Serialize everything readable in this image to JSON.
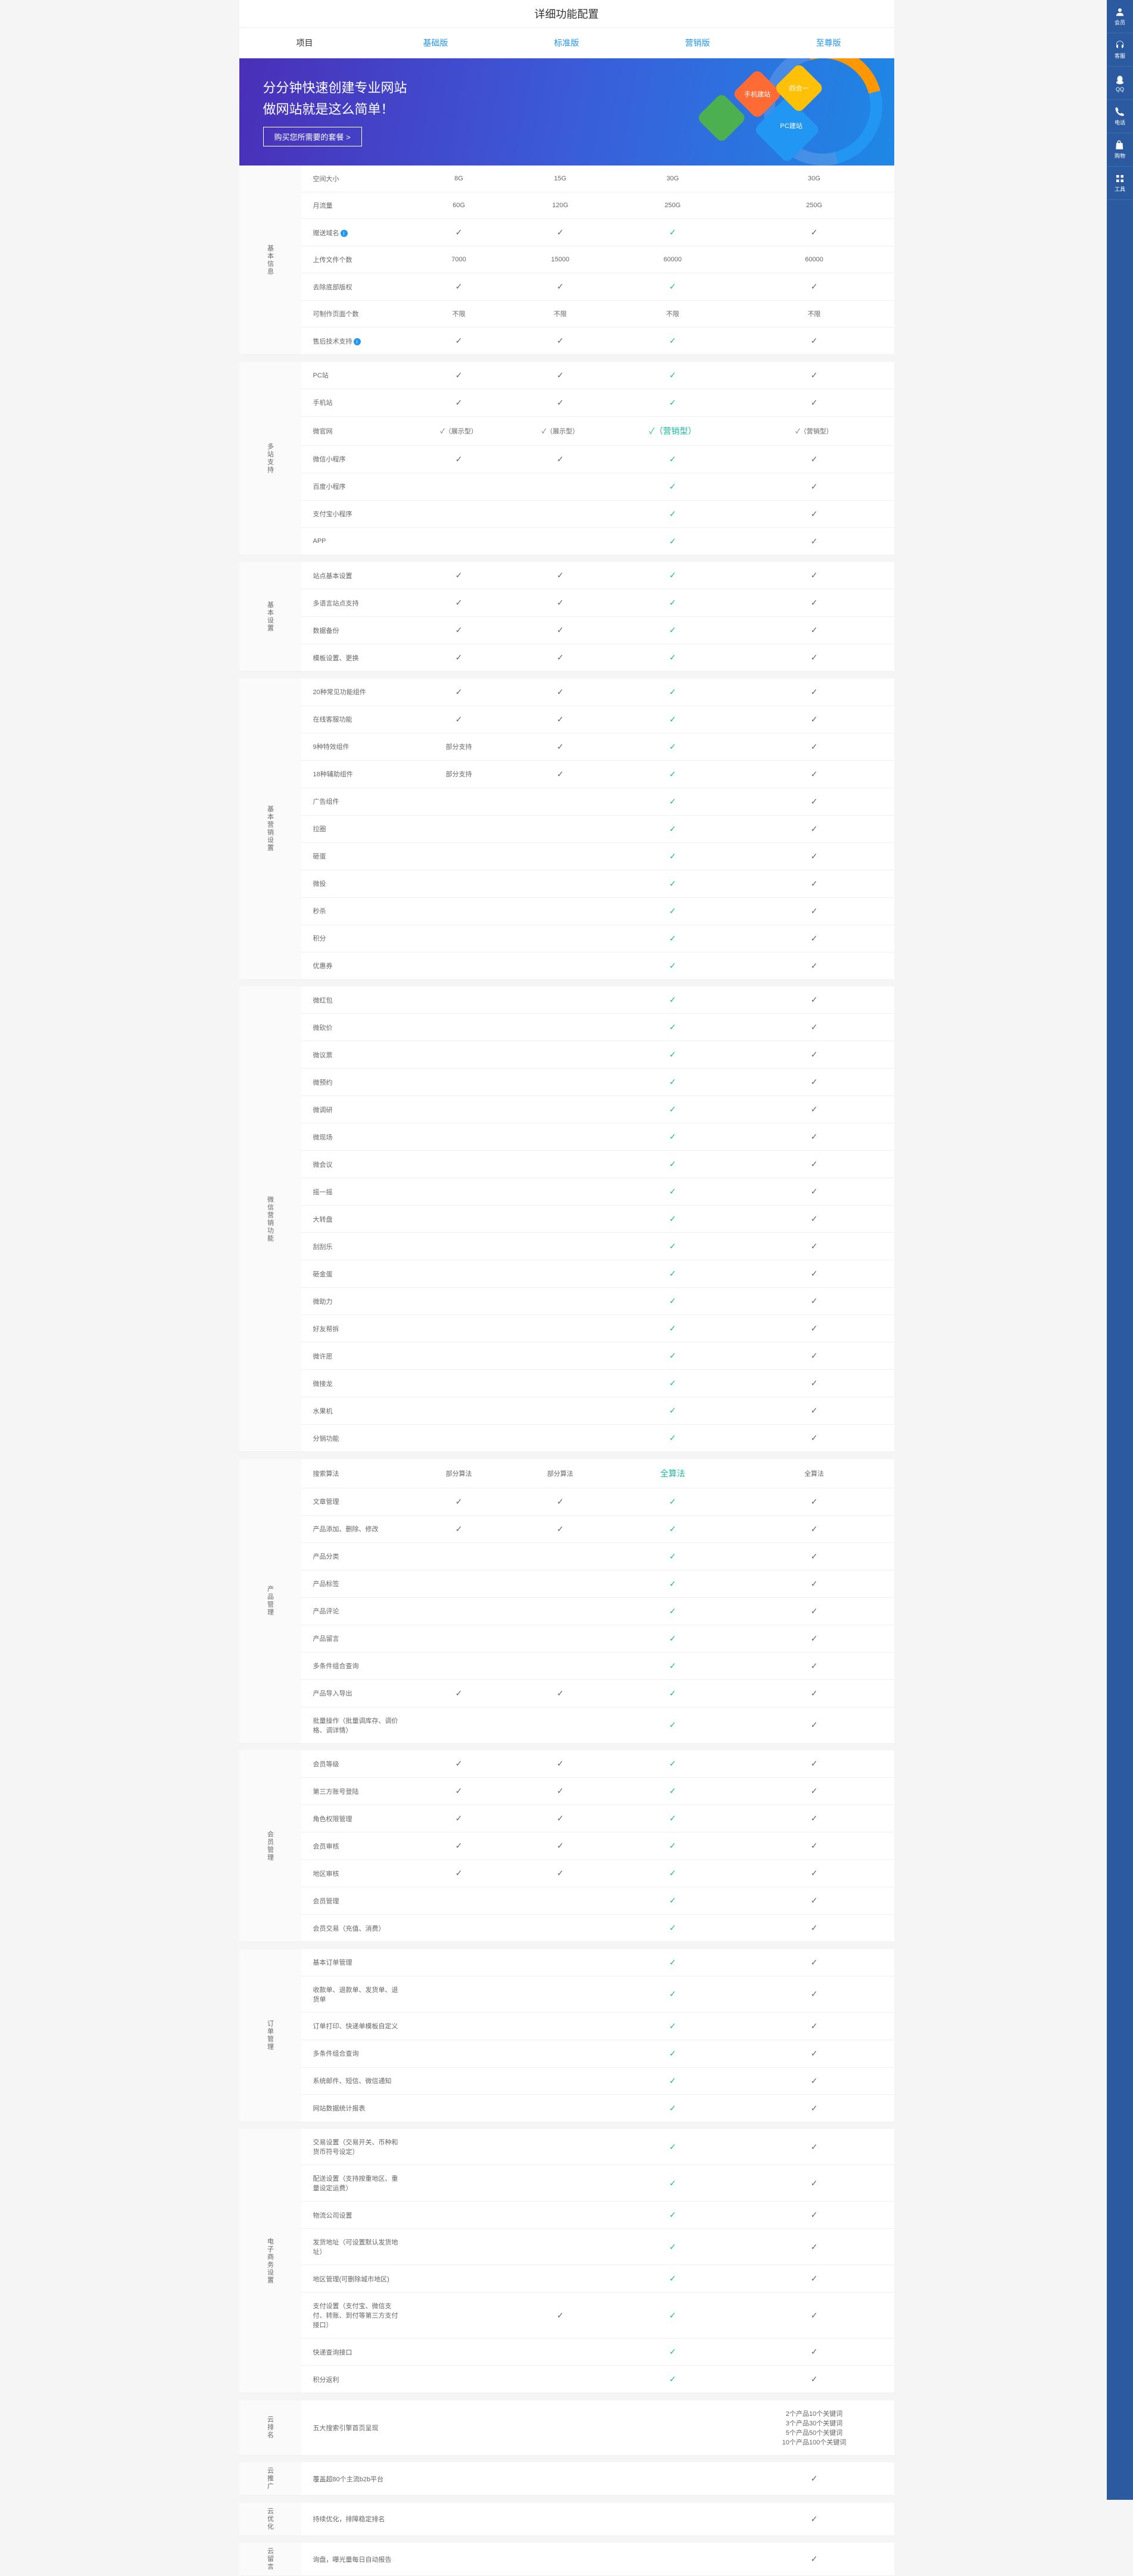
{
  "title": "详细功能配置",
  "tabs": [
    "项目",
    "基础版",
    "标准版",
    "营销版",
    "至尊版"
  ],
  "hero": {
    "line1": "分分钟快速创建专业网站",
    "line2": "做网站就是这么简单！",
    "btn": "购买您所需要的套餐 >",
    "cube1": "手机建站",
    "cube2": "",
    "cube3": "PC建站",
    "cube4": "四合一"
  },
  "sidebar": [
    {
      "icon": "user",
      "label": "会员"
    },
    {
      "icon": "headset",
      "label": "客服"
    },
    {
      "icon": "qq",
      "label": "QQ"
    },
    {
      "icon": "phone",
      "label": "电话"
    },
    {
      "icon": "bag",
      "label": "购物"
    },
    {
      "icon": "tool",
      "label": "工具"
    }
  ],
  "sections": [
    {
      "cat": "基本信息",
      "rows": [
        {
          "f": "空间大小",
          "v": [
            "8G",
            "15G",
            "30G",
            "30G"
          ]
        },
        {
          "f": "月流量",
          "v": [
            "60G",
            "120G",
            "250G",
            "250G"
          ]
        },
        {
          "f": "赠送域名",
          "info": true,
          "v": [
            "ck",
            "ck",
            "ckg",
            "ck"
          ]
        },
        {
          "f": "上传文件个数",
          "v": [
            "7000",
            "15000",
            "60000",
            "60000"
          ]
        },
        {
          "f": "去除底部版权",
          "v": [
            "ck",
            "ck",
            "ckg",
            "ck"
          ]
        },
        {
          "f": "可制作页面个数",
          "v": [
            "不限",
            "不限",
            "不限",
            "不限"
          ]
        },
        {
          "f": "售后技术支持",
          "info": true,
          "v": [
            "ck",
            "ck",
            "ckg",
            "ck"
          ]
        }
      ]
    },
    {
      "cat": "多站支持",
      "rows": [
        {
          "f": "PC站",
          "v": [
            "ck",
            "ck",
            "ckg",
            "ck"
          ]
        },
        {
          "f": "手机站",
          "v": [
            "ck",
            "ck",
            "ckg",
            "ck"
          ]
        },
        {
          "f": "微官网",
          "v": [
            "✓（展示型）",
            "✓（展示型）",
            "✓（营销型）",
            "✓（营销型）"
          ],
          "green3": true
        },
        {
          "f": "微信小程序",
          "v": [
            "ck",
            "ck",
            "ckg",
            "ck"
          ]
        },
        {
          "f": "百度小程序",
          "v": [
            "",
            "",
            "ckg",
            "ck"
          ]
        },
        {
          "f": "支付宝小程序",
          "v": [
            "",
            "",
            "ckg",
            "ck"
          ]
        },
        {
          "f": "APP",
          "v": [
            "",
            "",
            "ckg",
            "ck"
          ]
        }
      ]
    },
    {
      "cat": "基本设置",
      "rows": [
        {
          "f": "站点基本设置",
          "v": [
            "ck",
            "ck",
            "ckg",
            "ck"
          ]
        },
        {
          "f": "多语言站点支持",
          "v": [
            "ck",
            "ck",
            "ckg",
            "ck"
          ]
        },
        {
          "f": "数据备份",
          "v": [
            "ck",
            "ck",
            "ckg",
            "ck"
          ]
        },
        {
          "f": "模板设置、更换",
          "v": [
            "ck",
            "ck",
            "ckg",
            "ck"
          ]
        }
      ]
    },
    {
      "cat": "基本营销设置",
      "rows": [
        {
          "f": "20种常见功能组件",
          "v": [
            "ck",
            "ck",
            "ckg",
            "ck"
          ]
        },
        {
          "f": "在线客服功能",
          "v": [
            "ck",
            "ck",
            "ckg",
            "ck"
          ]
        },
        {
          "f": "9种特效组件",
          "v": [
            "部分支持",
            "ck",
            "ckg",
            "ck"
          ]
        },
        {
          "f": "18种辅助组件",
          "v": [
            "部分支持",
            "ck",
            "ckg",
            "ck"
          ]
        },
        {
          "f": "广告组件",
          "v": [
            "",
            "",
            "ckg",
            "ck"
          ]
        },
        {
          "f": "拉圈",
          "v": [
            "",
            "",
            "ckg",
            "ck"
          ]
        },
        {
          "f": "砸蛋",
          "v": [
            "",
            "",
            "ckg",
            "ck"
          ]
        },
        {
          "f": "微投",
          "v": [
            "",
            "",
            "ckg",
            "ck"
          ]
        },
        {
          "f": "秒杀",
          "v": [
            "",
            "",
            "ckg",
            "ck"
          ]
        },
        {
          "f": "积分",
          "v": [
            "",
            "",
            "ckg",
            "ck"
          ]
        },
        {
          "f": "优惠券",
          "v": [
            "",
            "",
            "ckg",
            "ck"
          ]
        }
      ]
    },
    {
      "cat": "微信营销功能",
      "rows": [
        {
          "f": "微红包",
          "v": [
            "",
            "",
            "ckg",
            "ck"
          ]
        },
        {
          "f": "微砍价",
          "v": [
            "",
            "",
            "ckg",
            "ck"
          ]
        },
        {
          "f": "微议票",
          "v": [
            "",
            "",
            "ckg",
            "ck"
          ]
        },
        {
          "f": "微预约",
          "v": [
            "",
            "",
            "ckg",
            "ck"
          ]
        },
        {
          "f": "微调研",
          "v": [
            "",
            "",
            "ckg",
            "ck"
          ]
        },
        {
          "f": "微现场",
          "v": [
            "",
            "",
            "ckg",
            "ck"
          ]
        },
        {
          "f": "微会议",
          "v": [
            "",
            "",
            "ckg",
            "ck"
          ]
        },
        {
          "f": "摇一摇",
          "v": [
            "",
            "",
            "ckg",
            "ck"
          ]
        },
        {
          "f": "大转盘",
          "v": [
            "",
            "",
            "ckg",
            "ck"
          ]
        },
        {
          "f": "刮刮乐",
          "v": [
            "",
            "",
            "ckg",
            "ck"
          ]
        },
        {
          "f": "砸金蛋",
          "v": [
            "",
            "",
            "ckg",
            "ck"
          ]
        },
        {
          "f": "微助力",
          "v": [
            "",
            "",
            "ckg",
            "ck"
          ]
        },
        {
          "f": "好友帮拆",
          "v": [
            "",
            "",
            "ckg",
            "ck"
          ]
        },
        {
          "f": "微许愿",
          "v": [
            "",
            "",
            "ckg",
            "ck"
          ]
        },
        {
          "f": "微接龙",
          "v": [
            "",
            "",
            "ckg",
            "ck"
          ]
        },
        {
          "f": "水果机",
          "v": [
            "",
            "",
            "ckg",
            "ck"
          ]
        },
        {
          "f": "分销功能",
          "v": [
            "",
            "",
            "ckg",
            "ck"
          ]
        }
      ]
    },
    {
      "cat": "产品管理",
      "rows": [
        {
          "f": "搜索算法",
          "v": [
            "部分算法",
            "部分算法",
            "全算法",
            "全算法"
          ],
          "green3": true
        },
        {
          "f": "文章管理",
          "v": [
            "ck",
            "ck",
            "ckg",
            "ck"
          ]
        },
        {
          "f": "产品添加、删除、修改",
          "v": [
            "ck",
            "ck",
            "ckg",
            "ck"
          ]
        },
        {
          "f": "产品分类",
          "v": [
            "",
            "",
            "ckg",
            "ck"
          ]
        },
        {
          "f": "产品标签",
          "v": [
            "",
            "",
            "ckg",
            "ck"
          ]
        },
        {
          "f": "产品评论",
          "v": [
            "",
            "",
            "ckg",
            "ck"
          ]
        },
        {
          "f": "产品留言",
          "v": [
            "",
            "",
            "ckg",
            "ck"
          ]
        },
        {
          "f": "多条件组合查询",
          "v": [
            "",
            "",
            "ckg",
            "ck"
          ]
        },
        {
          "f": "产品导入导出",
          "v": [
            "ck",
            "ck",
            "ckg",
            "ck"
          ]
        },
        {
          "f": "批量操作（批量调库存、调价格、调详情）",
          "v": [
            "",
            "",
            "ckg",
            "ck"
          ]
        }
      ]
    },
    {
      "cat": "会员管理",
      "rows": [
        {
          "f": "会员等级",
          "v": [
            "ck",
            "ck",
            "ckg",
            "ck"
          ]
        },
        {
          "f": "第三方账号登陆",
          "v": [
            "ck",
            "ck",
            "ckg",
            "ck"
          ]
        },
        {
          "f": "角色权限管理",
          "v": [
            "ck",
            "ck",
            "ckg",
            "ck"
          ]
        },
        {
          "f": "会员审核",
          "v": [
            "ck",
            "ck",
            "ckg",
            "ck"
          ]
        },
        {
          "f": "地区审核",
          "v": [
            "ck",
            "ck",
            "ckg",
            "ck"
          ]
        },
        {
          "f": "会员管理",
          "v": [
            "",
            "",
            "ckg",
            "ck"
          ]
        },
        {
          "f": "会员交易（充值、消费）",
          "v": [
            "",
            "",
            "ckg",
            "ck"
          ]
        }
      ]
    },
    {
      "cat": "订单管理",
      "rows": [
        {
          "f": "基本订单管理",
          "v": [
            "",
            "",
            "ckg",
            "ck"
          ]
        },
        {
          "f": "收款单、退款单、发货单、退货单",
          "v": [
            "",
            "",
            "ckg",
            "ck"
          ]
        },
        {
          "f": "订单打印、快递单模板自定义",
          "v": [
            "",
            "",
            "ckg",
            "ck"
          ]
        },
        {
          "f": "多条件组合查询",
          "v": [
            "",
            "",
            "ckg",
            "ck"
          ]
        },
        {
          "f": "系统邮件、短信、微信通知",
          "v": [
            "",
            "",
            "ckg",
            "ck"
          ]
        },
        {
          "f": "网站数据统计报表",
          "v": [
            "",
            "",
            "ckg",
            "ck"
          ]
        }
      ]
    },
    {
      "cat": "电子商务设置",
      "rows": [
        {
          "f": "交易设置（交易开关、币种和货币符号设定）",
          "v": [
            "",
            "",
            "ckg",
            "ck"
          ]
        },
        {
          "f": "配送设置（支持按重地区、重量设定运费）",
          "v": [
            "",
            "",
            "ckg",
            "ck"
          ]
        },
        {
          "f": "物流公司设置",
          "v": [
            "",
            "",
            "ckg",
            "ck"
          ]
        },
        {
          "f": "发货地址（可设置默认发货地址）",
          "v": [
            "",
            "",
            "ckg",
            "ck"
          ]
        },
        {
          "f": "地区管理(可删除城市地区)",
          "v": [
            "",
            "",
            "ckg",
            "ck"
          ]
        },
        {
          "f": "支付设置（支付宝、微信支付、转账、到付等第三方支付接口）",
          "v": [
            "",
            "ck",
            "ckg",
            "ck"
          ]
        },
        {
          "f": "快递查询接口",
          "v": [
            "",
            "",
            "ckg",
            "ck"
          ]
        },
        {
          "f": "积分返利",
          "v": [
            "",
            "",
            "ckg",
            "ck"
          ]
        }
      ]
    },
    {
      "cat": "云排名",
      "rows": [
        {
          "f": "五大搜索引擎首页呈现",
          "v": [
            "",
            "",
            "",
            "2个产品10个关键词\n3个产品30个关键词\n5个产品50个关键词\n10个产品100个关键词"
          ]
        }
      ]
    },
    {
      "cat": "云推广",
      "rows": [
        {
          "f": "覆盖超80个主流b2b平台",
          "v": [
            "",
            "",
            "",
            "ck"
          ]
        }
      ]
    },
    {
      "cat": "云优化",
      "rows": [
        {
          "f": "持续优化，排障稳定排名",
          "v": [
            "",
            "",
            "",
            "ck"
          ]
        }
      ]
    },
    {
      "cat": "云留言",
      "rows": [
        {
          "f": "询盘，曝光量每日自动报告",
          "v": [
            "",
            "",
            "",
            "ck"
          ]
        }
      ]
    }
  ]
}
